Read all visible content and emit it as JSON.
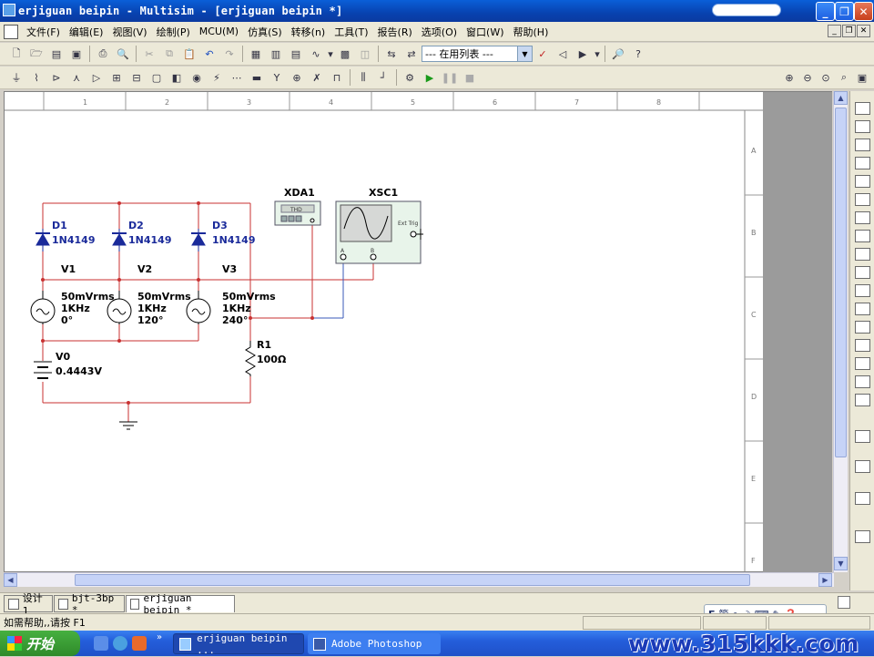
{
  "window": {
    "title": "erjiguan beipin - Multisim - [erjiguan beipin *]"
  },
  "menu": [
    "文件(F)",
    "编辑(E)",
    "视图(V)",
    "绘制(P)",
    "MCU(M)",
    "仿真(S)",
    "转移(n)",
    "工具(T)",
    "报告(R)",
    "选项(O)",
    "窗口(W)",
    "帮助(H)"
  ],
  "toolbar": {
    "inuse_list": "--- 在用列表 ---"
  },
  "ruler": {
    "columns": [
      "1",
      "2",
      "3",
      "4",
      "5",
      "6",
      "7",
      "8"
    ],
    "rows": [
      "A",
      "B",
      "C",
      "D",
      "E",
      "F"
    ]
  },
  "circuit": {
    "xda_label": "XDA1",
    "xda_display": "THD",
    "xsc_label": "XSC1",
    "xsc_ext": "Ext Trig",
    "xsc_a": "A",
    "xsc_b": "B",
    "diodes": [
      {
        "ref": "D1",
        "model": "1N4149"
      },
      {
        "ref": "D2",
        "model": "1N4149"
      },
      {
        "ref": "D3",
        "model": "1N4149"
      }
    ],
    "sources": [
      {
        "ref": "V1",
        "amp": "50mVrms",
        "freq": "1KHz",
        "phase": "0°"
      },
      {
        "ref": "V2",
        "amp": "50mVrms",
        "freq": "1KHz",
        "phase": "120°"
      },
      {
        "ref": "V3",
        "amp": "50mVrms",
        "freq": "1KHz",
        "phase": "240°"
      }
    ],
    "battery": {
      "ref": "V0",
      "value": "0.4443V"
    },
    "resistor": {
      "ref": "R1",
      "value": "100Ω"
    }
  },
  "tabs": [
    {
      "label": "设计1"
    },
    {
      "label": "bjt-3bp *"
    },
    {
      "label": "erjiguan beipin *"
    }
  ],
  "status": {
    "help": "如需帮助,,请按 F1"
  },
  "taskbar": {
    "start": "开始",
    "tasks": [
      "erjiguan beipin ...",
      "Adobe Photoshop"
    ]
  },
  "watermark": "www.315kkk.com",
  "colors": {
    "wire_red": "#c83232",
    "wire_blue": "#3a5ab8",
    "component_blue": "#1a2a9a"
  }
}
